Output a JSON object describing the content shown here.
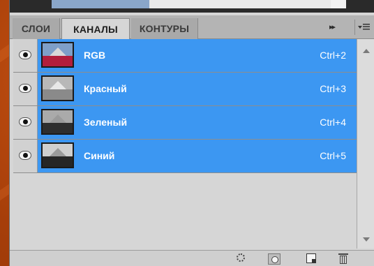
{
  "tabs": [
    {
      "label": "СЛОИ",
      "active": false
    },
    {
      "label": "КАНАЛЫ",
      "active": true
    },
    {
      "label": "КОНТУРЫ",
      "active": false
    }
  ],
  "panel_controls": {
    "collapse_glyph": "▸▸",
    "menu_icon": "panel-menu-icon"
  },
  "channels": [
    {
      "name": "RGB",
      "shortcut": "Ctrl+2",
      "thumbnail": "rgb",
      "visible": true,
      "selected": true
    },
    {
      "name": "Красный",
      "shortcut": "Ctrl+3",
      "thumbnail": "red",
      "visible": true,
      "selected": true
    },
    {
      "name": "Зеленый",
      "shortcut": "Ctrl+4",
      "thumbnail": "green",
      "visible": true,
      "selected": true
    },
    {
      "name": "Синий",
      "shortcut": "Ctrl+5",
      "thumbnail": "blue",
      "visible": true,
      "selected": true
    }
  ],
  "footer_icons": [
    "load-selection-icon",
    "save-selection-icon",
    "new-channel-icon",
    "delete-channel-icon"
  ],
  "colors": {
    "selection": "#3c97f2",
    "panel_bg": "#d6d6d6",
    "tab_bar": "#b4b4b4",
    "background": "#a63e0a"
  }
}
